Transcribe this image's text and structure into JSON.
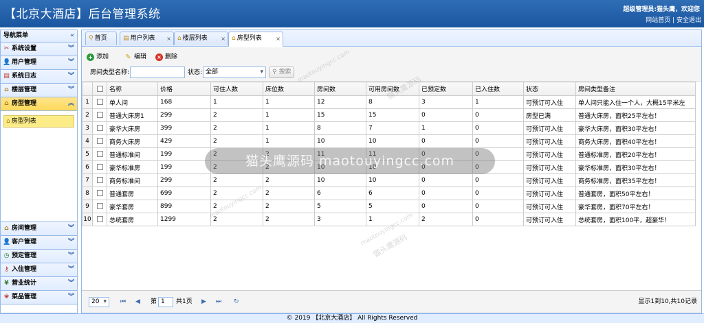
{
  "header": {
    "title": "【北京大酒店】后台管理系统",
    "user_text": "超级管理员:猫头鹰，欢迎您",
    "link_home": "网站首页",
    "link_sep": "|",
    "link_logout": "安全退出"
  },
  "sidebar": {
    "title": "导航菜单",
    "top_items": [
      {
        "label": "系统设置",
        "icon": "tools-icon"
      },
      {
        "label": "用户管理",
        "icon": "user-icon"
      },
      {
        "label": "系统日志",
        "icon": "log-icon"
      },
      {
        "label": "楼层管理",
        "icon": "building-icon"
      },
      {
        "label": "房型管理",
        "icon": "home-icon"
      }
    ],
    "sub_item": "房型列表",
    "bottom_items": [
      {
        "label": "房间管理",
        "icon": "home-icon"
      },
      {
        "label": "客户管理",
        "icon": "user-icon"
      },
      {
        "label": "预定管理",
        "icon": "clock-icon"
      },
      {
        "label": "入住管理",
        "icon": "key-icon"
      },
      {
        "label": "营业统计",
        "icon": "yen-icon"
      },
      {
        "label": "菜品管理",
        "icon": "dish-icon"
      }
    ]
  },
  "tabs": [
    {
      "label": "首页",
      "closable": false
    },
    {
      "label": "用户列表",
      "closable": true
    },
    {
      "label": "楼层列表",
      "closable": true
    },
    {
      "label": "房型列表",
      "closable": true,
      "active": true
    }
  ],
  "toolbar": {
    "add": "添加",
    "edit": "编辑",
    "delete": "删除",
    "name_label": "房间类型名称:",
    "name_value": "",
    "status_label": "状态:",
    "status_value": "全部",
    "search": "搜索"
  },
  "grid": {
    "columns": [
      "名称",
      "价格",
      "可住人数",
      "床位数",
      "房间数",
      "可用房间数",
      "已预定数",
      "已入住数",
      "状态",
      "房间类型备注"
    ],
    "rows": [
      [
        "1",
        "单人间",
        "168",
        "1",
        "1",
        "12",
        "8",
        "3",
        "1",
        "可预订可入住",
        "单人间只能入住一个人，大概15平米左"
      ],
      [
        "2",
        "普通大床房1",
        "299",
        "2",
        "1",
        "15",
        "15",
        "0",
        "0",
        "房型已满",
        "普通大床房，面积25平左右！"
      ],
      [
        "3",
        "豪华大床房",
        "399",
        "2",
        "1",
        "8",
        "7",
        "1",
        "0",
        "可预订可入住",
        "豪华大床房，面积30平左右！"
      ],
      [
        "4",
        "商务大床房",
        "429",
        "2",
        "1",
        "10",
        "10",
        "0",
        "0",
        "可预订可入住",
        "商务大床房，面积40平左右！"
      ],
      [
        "5",
        "普通标准间",
        "199",
        "2",
        "2",
        "11",
        "11",
        "0",
        "0",
        "可预订可入住",
        "普通标准房，面积20平左右！"
      ],
      [
        "6",
        "豪华标准房",
        "199",
        "2",
        "2",
        "10",
        "10",
        "0",
        "0",
        "可预订可入住",
        "豪华标准房，面积30平左右！"
      ],
      [
        "7",
        "商务标准间",
        "299",
        "2",
        "2",
        "10",
        "10",
        "0",
        "0",
        "可预订可入住",
        "商务标准房，面积35平左右！"
      ],
      [
        "8",
        "普通套房",
        "699",
        "2",
        "2",
        "6",
        "6",
        "0",
        "0",
        "可预订可入住",
        "普通套房，面积50平左右！"
      ],
      [
        "9",
        "豪华套房",
        "899",
        "2",
        "2",
        "5",
        "5",
        "0",
        "0",
        "可预订可入住",
        "豪华套房，面积70平左右！"
      ],
      [
        "10",
        "总统套房",
        "1299",
        "2",
        "2",
        "3",
        "1",
        "2",
        "0",
        "可预订可入住",
        "总统套房，面积100平，超豪华！"
      ]
    ]
  },
  "pager": {
    "page_size": "20",
    "page_label_pre": "第",
    "page_value": "1",
    "page_label_post": "共1页",
    "info": "显示1到10,共10记录"
  },
  "footer": "© 2019 【北京大酒店】 All Rights Reserved",
  "watermark": {
    "band": "猫头鹰源码 maotouyingcc.com",
    "small": "猫头鹰源码",
    "small_url": "maotouyingcc.com"
  },
  "colors": {
    "header_blue": "#1a56a0",
    "panel_border": "#95b8e7",
    "active_accordion": "#ffd95a",
    "sub_item": "#fbec88"
  }
}
